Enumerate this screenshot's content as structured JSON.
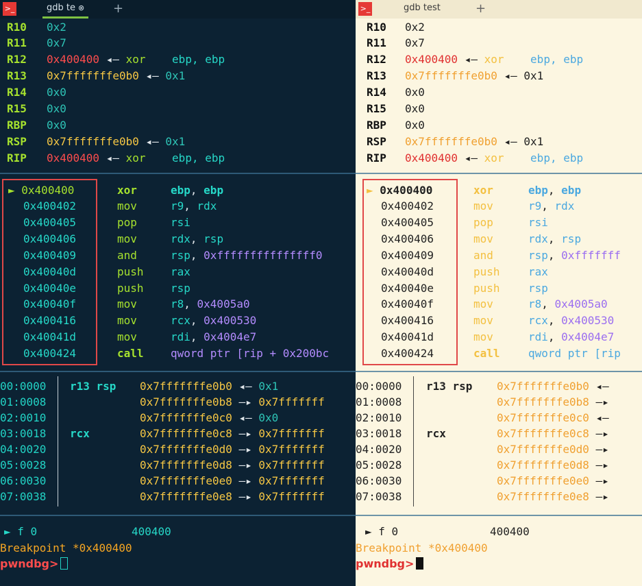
{
  "left_pane": {
    "tab_title": "gdb te",
    "tab_close_glyph": "⊗",
    "add_tab_glyph": "+",
    "registers": [
      {
        "name": "R10",
        "value": "0x2",
        "ref": "",
        "ins": "",
        "ops": ""
      },
      {
        "name": "R11",
        "value": "0x7",
        "ref": "",
        "ins": "",
        "ops": ""
      },
      {
        "name": "R12",
        "value": "0x400400",
        "arrow": "◂—",
        "ins": "xor",
        "ops": "ebp, ebp"
      },
      {
        "name": "R13",
        "value": "0x7fffffffe0b0",
        "arrow": "◂—",
        "target": "0x1"
      },
      {
        "name": "R14",
        "value": "0x0"
      },
      {
        "name": "R15",
        "value": "0x0"
      },
      {
        "name": "RBP",
        "value": "0x0"
      },
      {
        "name": "RSP",
        "value": "0x7fffffffe0b0",
        "arrow": "◂—",
        "target": "0x1"
      },
      {
        "name": "RIP",
        "value": "0x400400",
        "arrow": "◂—",
        "ins": "xor",
        "ops": "ebp, ebp"
      }
    ],
    "disasm": [
      {
        "marker": "►",
        "addr": "0x400400",
        "ins": "xor",
        "op1": "ebp",
        "op2": "ebp",
        "current": true
      },
      {
        "marker": "",
        "addr": "0x400402",
        "ins": "mov",
        "op1": "r9",
        "op2": "rdx"
      },
      {
        "marker": "",
        "addr": "0x400405",
        "ins": "pop",
        "op1": "rsi",
        "op2": ""
      },
      {
        "marker": "",
        "addr": "0x400406",
        "ins": "mov",
        "op1": "rdx",
        "op2": "rsp"
      },
      {
        "marker": "",
        "addr": "0x400409",
        "ins": "and",
        "op1": "rsp",
        "op2": "0xfffffffffffffff0"
      },
      {
        "marker": "",
        "addr": "0x40040d",
        "ins": "push",
        "op1": "rax",
        "op2": ""
      },
      {
        "marker": "",
        "addr": "0x40040e",
        "ins": "push",
        "op1": "rsp",
        "op2": ""
      },
      {
        "marker": "",
        "addr": "0x40040f",
        "ins": "mov",
        "op1": "r8",
        "op2": "0x4005a0"
      },
      {
        "marker": "",
        "addr": "0x400416",
        "ins": "mov",
        "op1": "rcx",
        "op2": "0x400530"
      },
      {
        "marker": "",
        "addr": "0x40041d",
        "ins": "mov",
        "op1": "rdi",
        "op2": "0x4004e7"
      },
      {
        "marker": "",
        "addr": "0x400424",
        "ins": "call",
        "op1": "qword ptr [rip + 0x200bc",
        "op2": ""
      }
    ],
    "stack": [
      {
        "off": "00:0000",
        "tag": "r13 rsp",
        "addr": "0x7fffffffe0b0",
        "arrow": "◂—",
        "target": "0x1"
      },
      {
        "off": "01:0008",
        "tag": "",
        "addr": "0x7fffffffe0b8",
        "arrow": "—▸",
        "target": "0x7fffffff"
      },
      {
        "off": "02:0010",
        "tag": "",
        "addr": "0x7fffffffe0c0",
        "arrow": "◂—",
        "target": "0x0"
      },
      {
        "off": "03:0018",
        "tag": "rcx",
        "addr": "0x7fffffffe0c8",
        "arrow": "—▸",
        "target": "0x7fffffff"
      },
      {
        "off": "04:0020",
        "tag": "",
        "addr": "0x7fffffffe0d0",
        "arrow": "—▸",
        "target": "0x7fffffff"
      },
      {
        "off": "05:0028",
        "tag": "",
        "addr": "0x7fffffffe0d8",
        "arrow": "—▸",
        "target": "0x7fffffff"
      },
      {
        "off": "06:0030",
        "tag": "",
        "addr": "0x7fffffffe0e0",
        "arrow": "—▸",
        "target": "0x7fffffff"
      },
      {
        "off": "07:0038",
        "tag": "",
        "addr": "0x7fffffffe0e8",
        "arrow": "—▸",
        "target": "0x7fffffff"
      }
    ],
    "backtrace": {
      "marker": "►",
      "frame": "f 0",
      "addr": "400400"
    },
    "breakpoint": "Breakpoint *0x400400",
    "prompt": "pwndbg>"
  },
  "right_pane": {
    "tab_title": "gdb test",
    "add_tab_glyph": "+",
    "registers": [
      {
        "name": "R10",
        "value": "0x2"
      },
      {
        "name": "R11",
        "value": "0x7"
      },
      {
        "name": "R12",
        "value": "0x400400",
        "arrow": "◂—",
        "ins": "xor",
        "ops": "ebp, ebp"
      },
      {
        "name": "R13",
        "value": "0x7fffffffe0b0",
        "arrow": "◂—",
        "target": "0x1"
      },
      {
        "name": "R14",
        "value": "0x0"
      },
      {
        "name": "R15",
        "value": "0x0"
      },
      {
        "name": "RBP",
        "value": "0x0"
      },
      {
        "name": "RSP",
        "value": "0x7fffffffe0b0",
        "arrow": "◂—",
        "target": "0x1"
      },
      {
        "name": "RIP",
        "value": "0x400400",
        "arrow": "◂—",
        "ins": "xor",
        "ops": "ebp, ebp"
      }
    ],
    "disasm": [
      {
        "marker": "►",
        "addr": "0x400400",
        "ins": "xor",
        "op1": "ebp",
        "op2": "ebp",
        "current": true
      },
      {
        "marker": "",
        "addr": "0x400402",
        "ins": "mov",
        "op1": "r9",
        "op2": "rdx"
      },
      {
        "marker": "",
        "addr": "0x400405",
        "ins": "pop",
        "op1": "rsi",
        "op2": ""
      },
      {
        "marker": "",
        "addr": "0x400406",
        "ins": "mov",
        "op1": "rdx",
        "op2": "rsp"
      },
      {
        "marker": "",
        "addr": "0x400409",
        "ins": "and",
        "op1": "rsp",
        "op2": "0xfffffff"
      },
      {
        "marker": "",
        "addr": "0x40040d",
        "ins": "push",
        "op1": "rax",
        "op2": ""
      },
      {
        "marker": "",
        "addr": "0x40040e",
        "ins": "push",
        "op1": "rsp",
        "op2": ""
      },
      {
        "marker": "",
        "addr": "0x40040f",
        "ins": "mov",
        "op1": "r8",
        "op2": "0x4005a0"
      },
      {
        "marker": "",
        "addr": "0x400416",
        "ins": "mov",
        "op1": "rcx",
        "op2": "0x400530"
      },
      {
        "marker": "",
        "addr": "0x40041d",
        "ins": "mov",
        "op1": "rdi",
        "op2": "0x4004e7"
      },
      {
        "marker": "",
        "addr": "0x400424",
        "ins": "call",
        "op1": "qword ptr [rip",
        "op2": ""
      }
    ],
    "stack": [
      {
        "off": "00:0000",
        "tag": "r13 rsp",
        "addr": "0x7fffffffe0b0",
        "arrow": "◂—"
      },
      {
        "off": "01:0008",
        "tag": "",
        "addr": "0x7fffffffe0b8",
        "arrow": "—▸"
      },
      {
        "off": "02:0010",
        "tag": "",
        "addr": "0x7fffffffe0c0",
        "arrow": "◂—"
      },
      {
        "off": "03:0018",
        "tag": "rcx",
        "addr": "0x7fffffffe0c8",
        "arrow": "—▸"
      },
      {
        "off": "04:0020",
        "tag": "",
        "addr": "0x7fffffffe0d0",
        "arrow": "—▸"
      },
      {
        "off": "05:0028",
        "tag": "",
        "addr": "0x7fffffffe0d8",
        "arrow": "—▸"
      },
      {
        "off": "06:0030",
        "tag": "",
        "addr": "0x7fffffffe0e0",
        "arrow": "—▸"
      },
      {
        "off": "07:0038",
        "tag": "",
        "addr": "0x7fffffffe0e8",
        "arrow": "—▸"
      }
    ],
    "backtrace": {
      "marker": "►",
      "frame": "f 0",
      "addr": "400400"
    },
    "breakpoint": "Breakpoint *0x400400",
    "prompt": "pwndbg>"
  }
}
